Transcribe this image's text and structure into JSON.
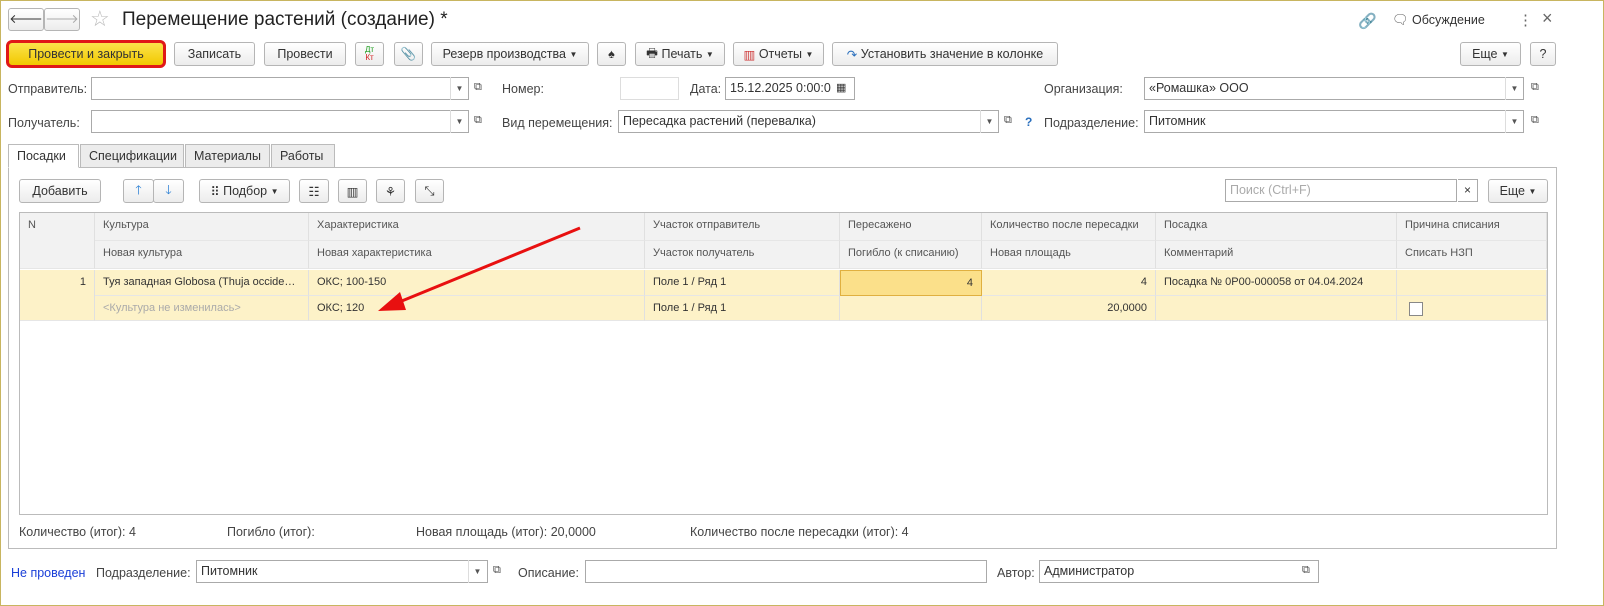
{
  "window": {
    "title": "Перемещение растений (создание) *",
    "discussion": "Обсуждение",
    "help": "?",
    "more_menu": "⋮",
    "close": "×"
  },
  "toolbar": {
    "post_close": "Провести и закрыть",
    "save": "Записать",
    "post": "Провести",
    "dtkt_dt": "Дт",
    "dtkt_kt": "Кт",
    "reserve": "Резерв производства",
    "print": "Печать",
    "reports": "Отчеты",
    "set_value": "Установить значение в колонке",
    "more": "Еще"
  },
  "header": {
    "sender_label": "Отправитель:",
    "sender_value": "",
    "receiver_label": "Получатель:",
    "receiver_value": "",
    "number_label": "Номер:",
    "number_value": "",
    "date_label": "Дата:",
    "date_value": "15.12.2025  0:00:0",
    "move_type_label": "Вид перемещения:",
    "move_type_value": "Пересадка растений (перевалка)",
    "org_label": "Организация:",
    "org_value": "«Ромашка» ООО",
    "division_label": "Подразделение:",
    "division_value": "Питомник",
    "help": "?"
  },
  "tabs": [
    "Посадки",
    "Спецификации",
    "Материалы",
    "Работы"
  ],
  "table_toolbar": {
    "add": "Добавить",
    "selection": "Подбор",
    "search_placeholder": "Поиск (Ctrl+F)",
    "more": "Еще"
  },
  "table": {
    "headers_top": [
      "N",
      "Культура",
      "Характеристика",
      "Участок отправитель",
      "Пересажено",
      "Количество после пересадки",
      "Посадка",
      "Причина списания"
    ],
    "headers_bottom": [
      "",
      "Новая культура",
      "Новая характеристика",
      "Участок получатель",
      "Погибло (к списанию)",
      "Новая площадь",
      "Комментарий",
      "Списать НЗП"
    ],
    "rows": [
      {
        "n": "1",
        "culture": "Туя западная Globosa (Thuja occident...",
        "char": "ОКС; 100-150",
        "plot_from": "Поле 1 / Ряд 1",
        "transplanted": "4",
        "qty_after": "4",
        "planting": "Посадка № 0Р00-000058 от 04.04.2024",
        "reason": "",
        "new_culture": "<Культура не изменилась>",
        "new_char": "ОКС; 120",
        "plot_to": "Поле 1 / Ряд 1",
        "died": "",
        "new_area": "20,0000",
        "comment": "",
        "write_off": false
      }
    ]
  },
  "totals": {
    "qty": "Количество (итог):  4",
    "died": "Погибло (итог):",
    "area": "Новая площадь (итог):  20,0000",
    "qty_after": "Количество после пересадки (итог):  4"
  },
  "footer": {
    "status": "Не проведен",
    "division_label": "Подразделение:",
    "division_value": "Питомник",
    "desc_label": "Описание:",
    "desc_value": "",
    "author_label": "Автор:",
    "author_value": "Администратор"
  }
}
